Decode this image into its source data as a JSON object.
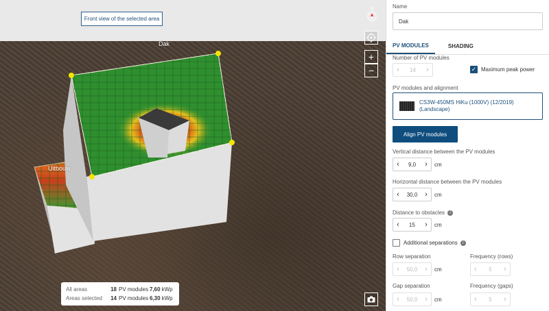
{
  "viewport": {
    "tooltip": "Front view of the selected area",
    "area_labels": {
      "main": "Dak",
      "annex": "Uitbouw"
    },
    "compass_letter": "N",
    "buttons": {
      "zoom_in": "+",
      "zoom_out": "−"
    }
  },
  "summary": {
    "rows": [
      {
        "label": "All areas",
        "count": "18",
        "unit": "PV modules",
        "power": "7,60",
        "power_unit": "kWp"
      },
      {
        "label": "Areas selected",
        "count": "14",
        "unit": "PV modules",
        "power": "6,30",
        "power_unit": "kWp"
      }
    ]
  },
  "panel": {
    "name_label": "Name",
    "name_value": "Dak",
    "tabs": [
      {
        "label": "PV MODULES",
        "active": true
      },
      {
        "label": "SHADING",
        "active": false
      }
    ],
    "num_modules_label": "Number of PV modules",
    "num_modules_value": "14",
    "max_peak_label": "Maximum peak power",
    "alignment_label": "PV modules and alignment",
    "module_name_line1": "CS3W-450MS HiKu (1000V) (12/2019)",
    "module_name_line2": "(Landscape)",
    "align_button": "Align PV modules",
    "vertical_label": "Vertical distance between the PV modules",
    "vertical_value": "9,0",
    "horizontal_label": "Horizontal distance between the PV modules",
    "horizontal_value": "30,0",
    "obstacles_label": "Distance to obstacles",
    "obstacles_value": "15",
    "unit_cm": "cm",
    "separations_label": "Additional separations",
    "row_sep_label": "Row separation",
    "row_sep_value": "50,0",
    "freq_rows_label": "Frequency (rows)",
    "freq_rows_value": "5",
    "gap_sep_label": "Gap separation",
    "gap_sep_value": "50,0",
    "freq_gaps_label": "Frequency (gaps)",
    "freq_gaps_value": "5"
  },
  "colors": {
    "accent": "#0f4d7e",
    "vertex": "#f5e400",
    "pv_green": "#2f8f2f"
  }
}
